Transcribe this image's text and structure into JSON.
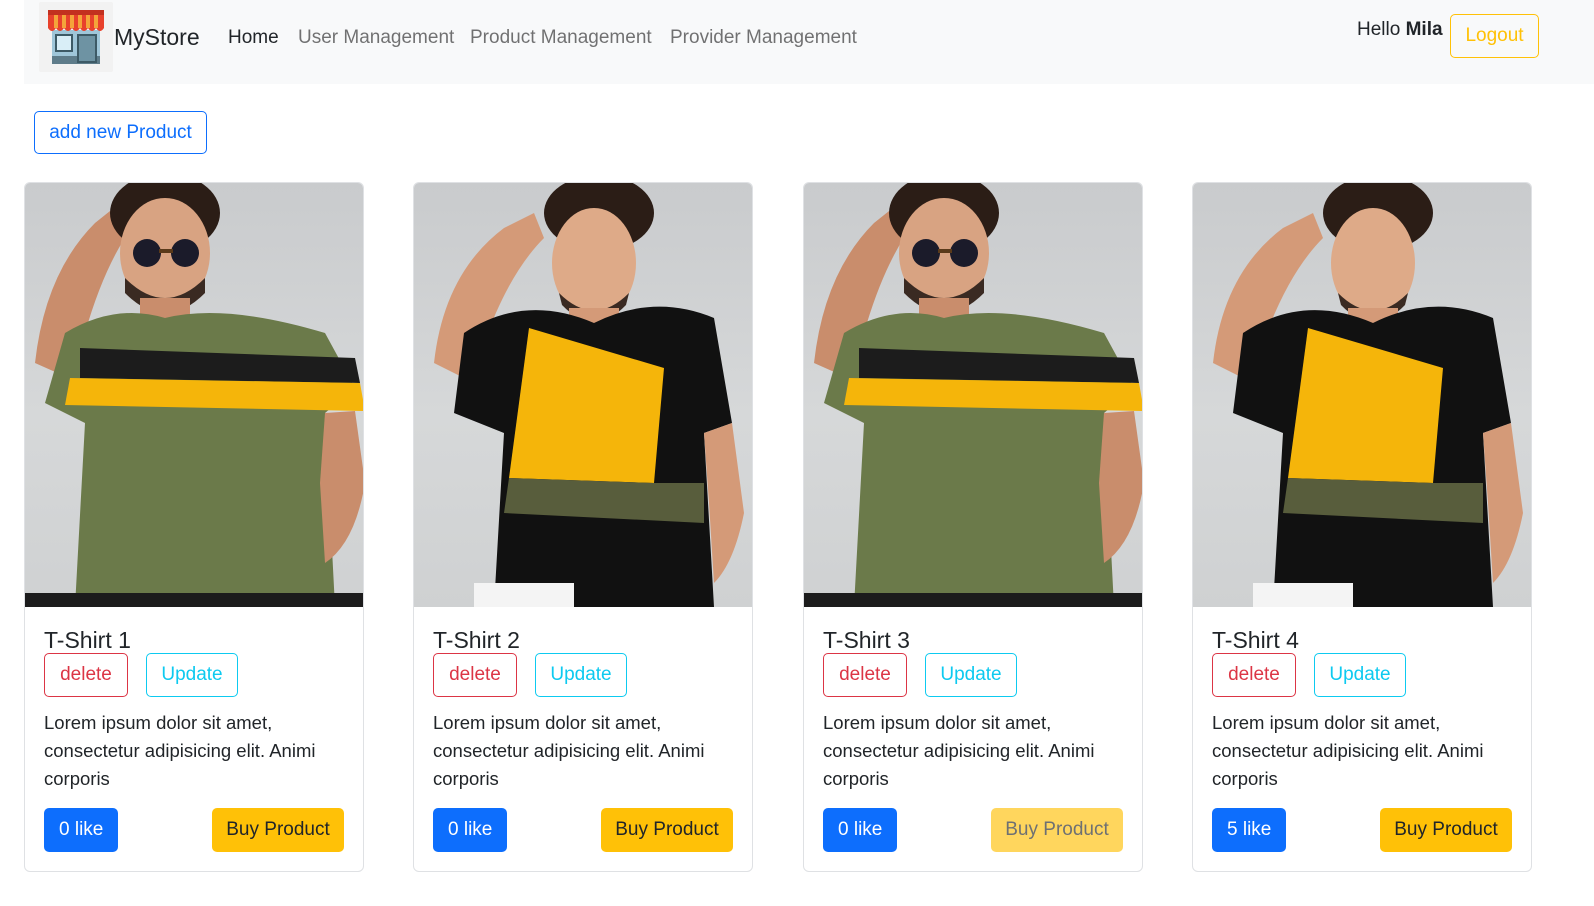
{
  "navbar": {
    "brand": "MyStore",
    "links": [
      "Home",
      "User Management",
      "Product Management",
      "Provider Management"
    ],
    "greeting": "Hello",
    "username": "Mila",
    "logout_label": "Logout"
  },
  "toolbar": {
    "add_label": "add new Product"
  },
  "products": [
    {
      "title": "T-Shirt 1",
      "delete_label": "delete",
      "update_label": "Update",
      "description": "Lorem ipsum dolor sit amet, consectetur adipisicing elit. Animi corporis",
      "likes": "0 like",
      "buy_label": "Buy Product",
      "buy_enabled": true,
      "image": "model-green-striped-tshirt"
    },
    {
      "title": "T-Shirt 2",
      "delete_label": "delete",
      "update_label": "Update",
      "description": "Lorem ipsum dolor sit amet, consectetur adipisicing elit. Animi corporis",
      "likes": "0 like",
      "buy_label": "Buy Product",
      "buy_enabled": true,
      "image": "model-black-yellow-tshirt"
    },
    {
      "title": "T-Shirt 3",
      "delete_label": "delete",
      "update_label": "Update",
      "description": "Lorem ipsum dolor sit amet, consectetur adipisicing elit. Animi corporis",
      "likes": "0 like",
      "buy_label": "Buy Product",
      "buy_enabled": false,
      "image": "model-green-striped-tshirt"
    },
    {
      "title": "T-Shirt 4",
      "delete_label": "delete",
      "update_label": "Update",
      "description": "Lorem ipsum dolor sit amet, consectetur adipisicing elit. Animi corporis",
      "likes": "5 like",
      "buy_label": "Buy Product",
      "buy_enabled": true,
      "image": "model-black-yellow-tshirt"
    }
  ],
  "colors": {
    "primary": "#0d6efd",
    "danger": "#dc3545",
    "info": "#0dcaf0",
    "warning": "#ffc107",
    "navbar_bg": "#f8f9fa"
  }
}
